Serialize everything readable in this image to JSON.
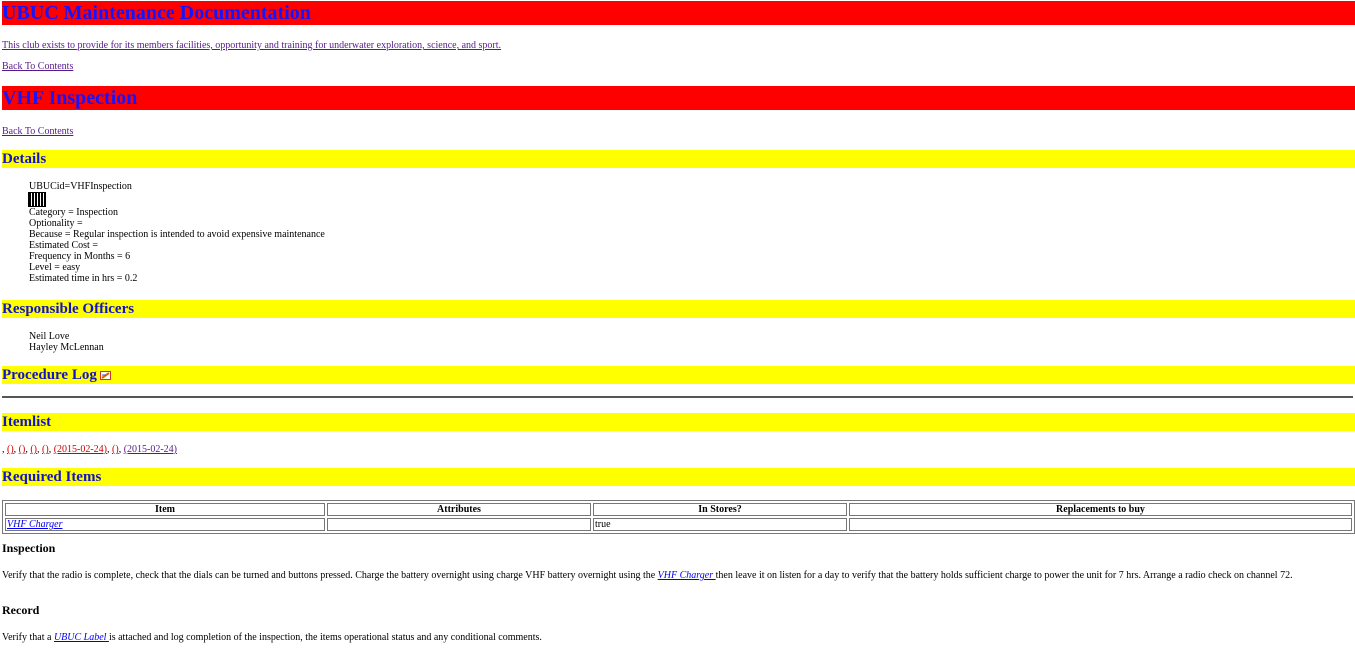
{
  "site": {
    "title": "UBUC Maintenance Documentation",
    "tagline": "This club exists to provide for its members facilities, opportunity and training for underwater exploration, science, and sport.",
    "back_link_1": "Back To Contents"
  },
  "page": {
    "title": "VHF Inspection",
    "back_link_2": "Back To Contents"
  },
  "details": {
    "heading": "Details",
    "ubucid": "UBUCid=VHFInspection",
    "category": "Category = Inspection",
    "optionality": "Optionality =",
    "because": "Because = Regular inspection is intended to avoid expensive maintenance",
    "cost": "Estimated Cost =",
    "frequency": "Frequency in Months = 6",
    "level": "Level = easy",
    "time": "Estimated time in hrs = 0.2"
  },
  "officers": {
    "heading": "Responsible Officers",
    "names": [
      "Neil Love",
      "Hayley McLennan"
    ]
  },
  "procedure_log": {
    "heading": "Procedure Log"
  },
  "itemlist": {
    "heading": "Itemlist",
    "prefix": ",",
    "links": [
      "()",
      "()",
      "()",
      "()",
      "(2015-02-24)",
      "()",
      "(2015-02-24)"
    ],
    "seps": [
      ", ",
      ", ",
      ", ",
      ", ",
      ", ",
      ", ",
      ""
    ]
  },
  "required_items": {
    "heading": "Required Items",
    "columns": [
      "Item",
      "Attributes",
      "In Stores?",
      "Replacements to buy"
    ],
    "rows": [
      {
        "item": "VHF Charger",
        "attributes": "",
        "in_stores": "true",
        "replacements": ""
      }
    ]
  },
  "inspection": {
    "heading": "Inspection",
    "text_before": "Verify that the radio is complete, check that the dials can be turned and buttons pressed. Charge the battery overnight using charge VHF battery overnight using the ",
    "link": "VHF Charger ",
    "text_after": "then leave it on listen for a day to verify that the battery holds sufficient charge to power the unit for 7 hrs. Arrange a radio check on channel 72."
  },
  "record": {
    "heading": "Record",
    "text_before": "Verify that a ",
    "link": "UBUC Label ",
    "text_after": "is attached and log completion of the inspection, the items operational status and any conditional comments."
  }
}
